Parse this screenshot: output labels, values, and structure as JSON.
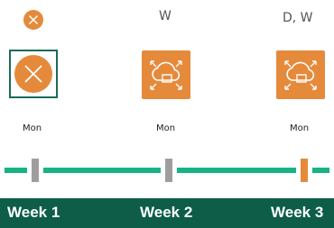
{
  "columns": [
    {
      "top_label": "",
      "top_icon": "cancel-circle-icon",
      "tile_icon": "cancel-circle-icon",
      "selected": true,
      "day": "Mon",
      "marker_color": "#9e9e9e"
    },
    {
      "top_label": "W",
      "top_icon": "",
      "tile_icon": "cloud-sync-icon",
      "selected": false,
      "day": "Mon",
      "marker_color": "#9e9e9e"
    },
    {
      "top_label": "D, W",
      "top_icon": "",
      "tile_icon": "cloud-sync-icon",
      "selected": false,
      "day": "Mon",
      "marker_color": "#e58a3b"
    }
  ],
  "weeks": [
    "Week 1",
    "Week 2",
    "Week 3"
  ],
  "colors": {
    "accent_orange": "#e58a3b",
    "track_green": "#17b385",
    "week_bar": "#0d5d48",
    "selection_border": "#1b6b59",
    "marker_gray": "#9e9e9e"
  }
}
